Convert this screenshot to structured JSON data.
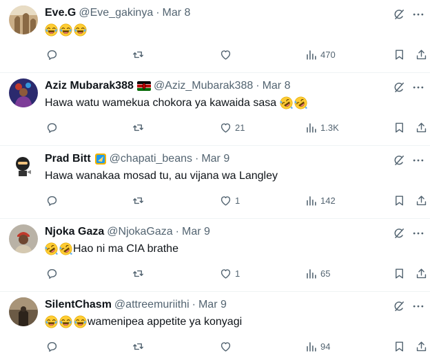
{
  "tweets": [
    {
      "name": "Eve.G",
      "handle": "@Eve_gakinya",
      "separator": "·",
      "date": "Mar 8",
      "leading_emojis": [
        "face-with-tears-of-joy",
        "face-with-tears-of-joy",
        "face-with-tears-of-joy"
      ],
      "text": "",
      "trailing_emojis": [],
      "badge": null,
      "stats": {
        "replies": "",
        "reposts": "",
        "likes": "",
        "views": "470"
      }
    },
    {
      "name": "Aziz Mubarak388",
      "handle": "@Aziz_Mubarak388",
      "separator": "·",
      "date": "Mar 8",
      "leading_emojis": [],
      "text": "Hawa watu wamekua chokora ya kawaida sasa ",
      "trailing_emojis": [
        "rolling-on-floor-laughing",
        "rolling-on-floor-laughing"
      ],
      "badge": "kenya-flag",
      "stats": {
        "replies": "",
        "reposts": "",
        "likes": "21",
        "views": "1.3K"
      }
    },
    {
      "name": "Prad Bitt",
      "handle": "@chapati_beans",
      "separator": "·",
      "date": "Mar 9",
      "leading_emojis": [],
      "text": "Hawa wanakaa mosad tu, au vijana wa Langley",
      "trailing_emojis": [],
      "badge": "verified-badge",
      "stats": {
        "replies": "",
        "reposts": "",
        "likes": "1",
        "views": "142"
      }
    },
    {
      "name": "Njoka Gaza",
      "handle": "@NjokaGaza",
      "separator": "·",
      "date": "Mar 9",
      "leading_emojis": [
        "rolling-on-floor-laughing",
        "rolling-on-floor-laughing"
      ],
      "text": "Hao ni  ma CIA brathe",
      "trailing_emojis": [],
      "badge": null,
      "stats": {
        "replies": "",
        "reposts": "",
        "likes": "1",
        "views": "65"
      }
    },
    {
      "name": "SilentChasm",
      "handle": "@attreemuriithi",
      "separator": "·",
      "date": "Mar 9",
      "leading_emojis": [
        "face-with-tears-of-joy",
        "face-with-tears-of-joy",
        "face-with-tears-of-joy"
      ],
      "text": "wamenipea appetite ya konyagi",
      "trailing_emojis": [],
      "badge": null,
      "stats": {
        "replies": "",
        "reposts": "",
        "likes": "",
        "views": "94"
      }
    }
  ],
  "colors": {
    "text_primary": "#0f1419",
    "text_secondary": "#536471",
    "divider": "#eff3f4",
    "emoji_yellow": "#ffcc33"
  },
  "icons": [
    "reply-icon",
    "repost-icon",
    "like-icon",
    "views-icon",
    "bookmark-icon",
    "share-icon",
    "grok-icon",
    "more-icon"
  ]
}
